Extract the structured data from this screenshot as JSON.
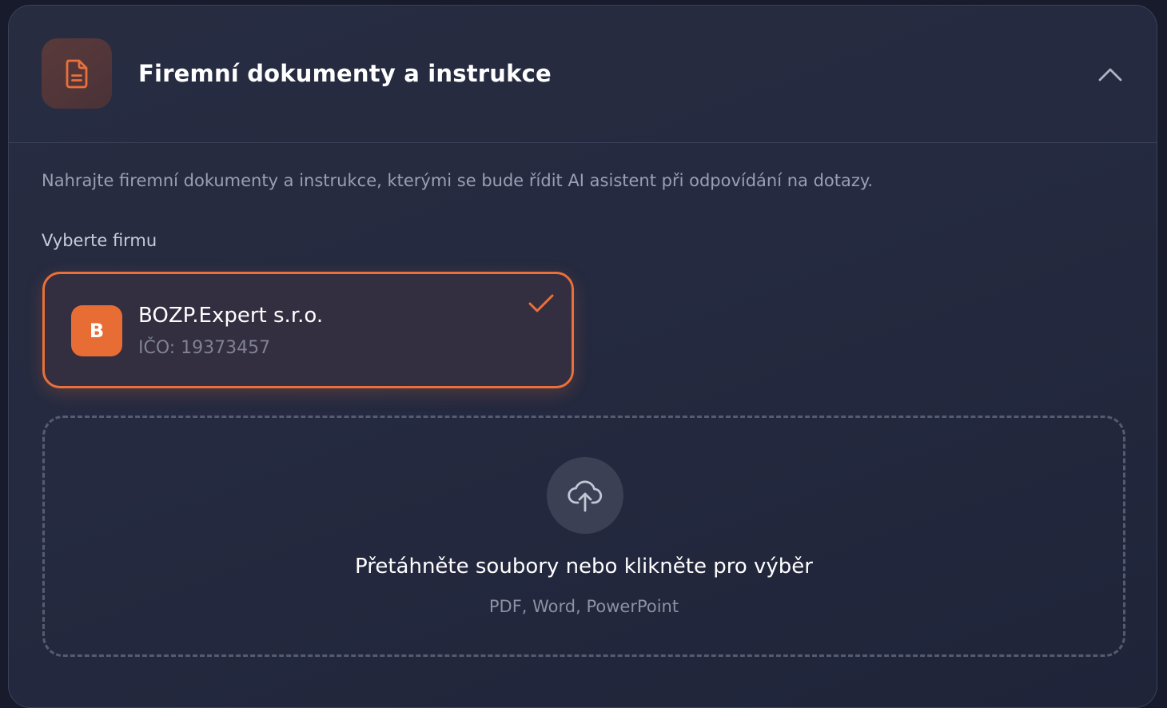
{
  "header": {
    "title": "Firemní dokumenty a instrukce",
    "icon": "document-icon",
    "collapse_icon": "chevron-up-icon"
  },
  "description": "Nahrajte firemní dokumenty a instrukce, kterými se bude řídit AI asistent při odpovídání na dotazy.",
  "company_section": {
    "label": "Vyberte firmu",
    "companies": [
      {
        "initial": "B",
        "name": "BOZP.Expert s.r.o.",
        "ico": "IČO: 19373457",
        "selected": true
      }
    ]
  },
  "dropzone": {
    "icon": "cloud-upload-icon",
    "title": "Přetáhněte soubory nebo klikněte pro výběr",
    "subtitle": "PDF, Word, PowerPoint"
  },
  "colors": {
    "accent": "#e9703a",
    "background": "#252a40",
    "border": "#3a4158",
    "text_primary": "#ffffff",
    "text_secondary": "#9aa0b4"
  }
}
